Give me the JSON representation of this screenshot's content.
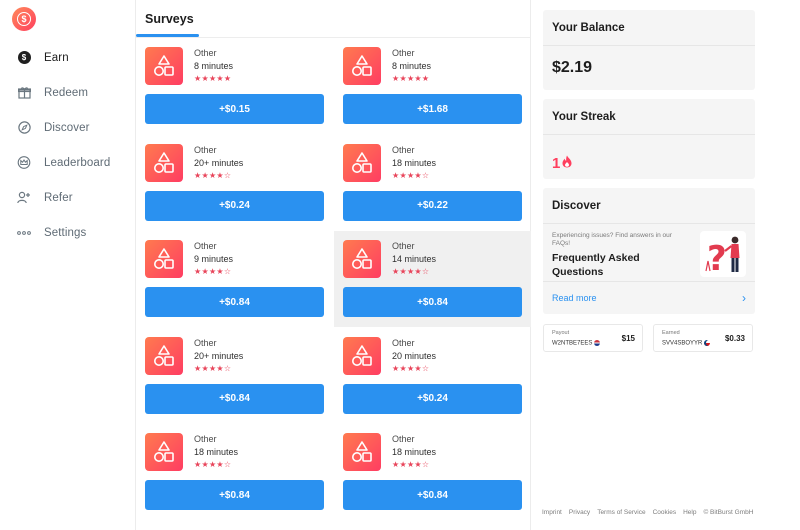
{
  "brand": {
    "logo_symbol": "$"
  },
  "sidebar": {
    "items": [
      {
        "label": "Earn",
        "icon": "dollar-coin-icon",
        "active": true
      },
      {
        "label": "Redeem",
        "icon": "gift-icon"
      },
      {
        "label": "Discover",
        "icon": "compass-icon"
      },
      {
        "label": "Leaderboard",
        "icon": "crown-icon"
      },
      {
        "label": "Refer",
        "icon": "add-user-icon"
      },
      {
        "label": "Settings",
        "icon": "more-dots-icon"
      }
    ]
  },
  "main": {
    "tab": "Surveys",
    "surveys": [
      {
        "category": "Other",
        "duration": "8 minutes",
        "stars": "★★★★★",
        "reward": "+$0.15"
      },
      {
        "category": "Other",
        "duration": "8 minutes",
        "stars": "★★★★★",
        "reward": "+$1.68"
      },
      {
        "category": "Other",
        "duration": "20+ minutes",
        "stars": "★★★★☆",
        "reward": "+$0.24"
      },
      {
        "category": "Other",
        "duration": "18 minutes",
        "stars": "★★★★☆",
        "reward": "+$0.22"
      },
      {
        "category": "Other",
        "duration": "9 minutes",
        "stars": "★★★★☆",
        "reward": "+$0.84"
      },
      {
        "category": "Other",
        "duration": "14 minutes",
        "stars": "★★★★☆",
        "reward": "+$0.84"
      },
      {
        "category": "Other",
        "duration": "20+ minutes",
        "stars": "★★★★☆",
        "reward": "+$0.84"
      },
      {
        "category": "Other",
        "duration": "20 minutes",
        "stars": "★★★★☆",
        "reward": "+$0.24"
      },
      {
        "category": "Other",
        "duration": "18 minutes",
        "stars": "★★★★☆",
        "reward": "+$0.84"
      },
      {
        "category": "Other",
        "duration": "18 minutes",
        "stars": "★★★★☆",
        "reward": "+$0.84"
      }
    ]
  },
  "balance": {
    "title": "Your Balance",
    "value": "$2.19"
  },
  "streak": {
    "title": "Your Streak",
    "value": "1",
    "icon": "flame-icon"
  },
  "discover": {
    "title": "Discover",
    "small_text": "Experiencing issues? Find answers in our FAQs!",
    "heading": "Frequently Asked Questions",
    "read_more": "Read more",
    "chevron": "›"
  },
  "tickers": [
    {
      "label": "Payout",
      "code": "W2NTBE7EES",
      "amount": "$15"
    },
    {
      "label": "Earned",
      "code": "SVV4SBOYYR",
      "amount": "$0.33"
    }
  ],
  "footer": [
    "Imprint",
    "Privacy",
    "Terms of Service",
    "Cookies",
    "Help",
    "© BitBurst GmbH"
  ],
  "colors": {
    "accent": "#2a91f0",
    "brand_start": "#ff7a4f",
    "brand_end": "#ff3d62",
    "star": "#e8445a"
  }
}
